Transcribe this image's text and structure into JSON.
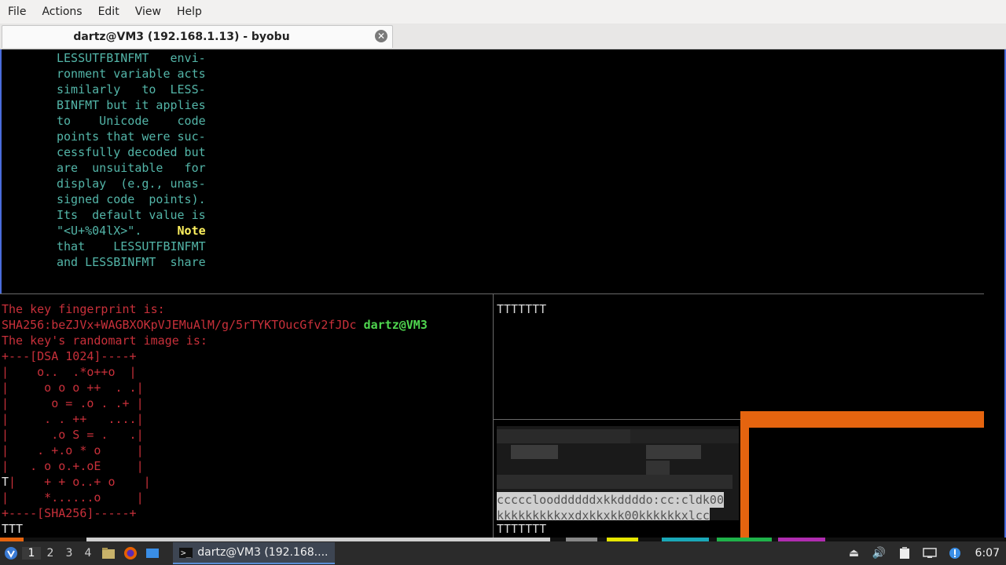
{
  "menu": [
    "File",
    "Actions",
    "Edit",
    "View",
    "Help"
  ],
  "tab": {
    "title": "dartz@VM3 (192.168.1.13) - byobu",
    "close_icon": "close-icon"
  },
  "top_pane": {
    "lines": [
      "LESSUTFBINFMT   envi-",
      "ronment variable acts",
      "similarly   to  LESS-",
      "BINFMT but it applies",
      "to    Unicode    code",
      "points that were suc-",
      "cessfully decoded but",
      "are  unsuitable   for",
      "display  (e.g., unas-",
      "signed code  points).",
      "Its  default value is",
      "that    LESSUTFBINFMT",
      "and LESSBINFMT  share"
    ],
    "line_before_note": "\"<U+%04lX>\".",
    "note": "Note"
  },
  "left_pane": {
    "line1": "The key fingerprint is:",
    "fingerprint": "SHA256:beZJVx+WAGBXOKpVJEMuAlM/g/5rTYKTOucGfv2fJDc",
    "user": "dartz@VM3",
    "line3": "The key's randomart image is:",
    "art": [
      "+---[DSA 1024]----+",
      "|    o..  .*o++o  |",
      "|     o o o ++  . .|",
      "|      o = .o . .+ |",
      "|     . . ++   ....|",
      "|      .o S = .   .|",
      "|    . +.o * o     |",
      "|   . o o.+.oE     |"
    ],
    "art_t_prefix": "T",
    "art_t_row": "|    + + o..+ o    |",
    "art_rest": [
      "|     *......o     |",
      "+----[SHA256]-----+"
    ],
    "last": "TTT"
  },
  "right_pane": {
    "top_text": "TTTTTTT",
    "art_row1": "ccccclooddddddxkkddddo:cc:cldk00",
    "art_row2": "kkkkkkkkkxxdxkkxkk00kkkkkkxlcc",
    "bottom_text": "TTTTTTT"
  },
  "colors": {
    "fingerprint_red": "#c8303a",
    "user_green": "#4fd64f",
    "man_text": "#53b5a8",
    "note_yellow": "#fff25f",
    "orange": "#e5640f"
  },
  "taskbar": {
    "start_icon": "distro-logo-icon",
    "workspaces": [
      "1",
      "2",
      "3",
      "4"
    ],
    "active_workspace": "1",
    "launchers": [
      "file-manager-icon",
      "firefox-icon",
      "desktop-icon"
    ],
    "task_label": "dartz@VM3 (192.168....",
    "tray_icons": [
      "eject-icon",
      "volume-icon",
      "clipboard-icon",
      "network-icon",
      "notification-icon"
    ],
    "clock": "6:07"
  }
}
